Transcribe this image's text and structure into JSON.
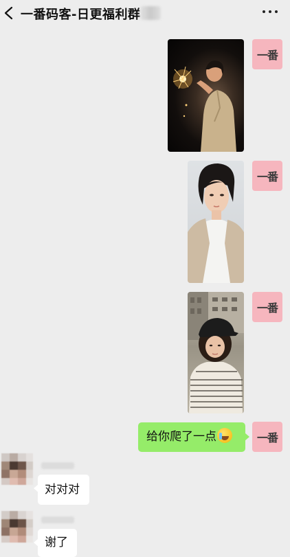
{
  "header": {
    "title": "一番码客-日更福利群",
    "back_icon": "chevron-left-icon",
    "more_icon": "more-dots-icon"
  },
  "self": {
    "avatar_text": "一番",
    "avatar_color": "#f6b6be"
  },
  "messages": [
    {
      "sender": "self",
      "type": "image",
      "description": "woman with sparkler at night"
    },
    {
      "sender": "self",
      "type": "image",
      "description": "short-haired woman in white top"
    },
    {
      "sender": "self",
      "type": "image",
      "description": "woman in cap and striped shirt"
    },
    {
      "sender": "self",
      "type": "text",
      "text": "给你爬了一点",
      "emoji": "crying-laughing-emoji"
    },
    {
      "sender": "other",
      "type": "text",
      "text": "对对对"
    },
    {
      "sender": "other",
      "type": "text",
      "text": "谢了"
    }
  ],
  "colors": {
    "background": "#ededed",
    "self_bubble": "#95ec69",
    "other_bubble": "#ffffff"
  }
}
